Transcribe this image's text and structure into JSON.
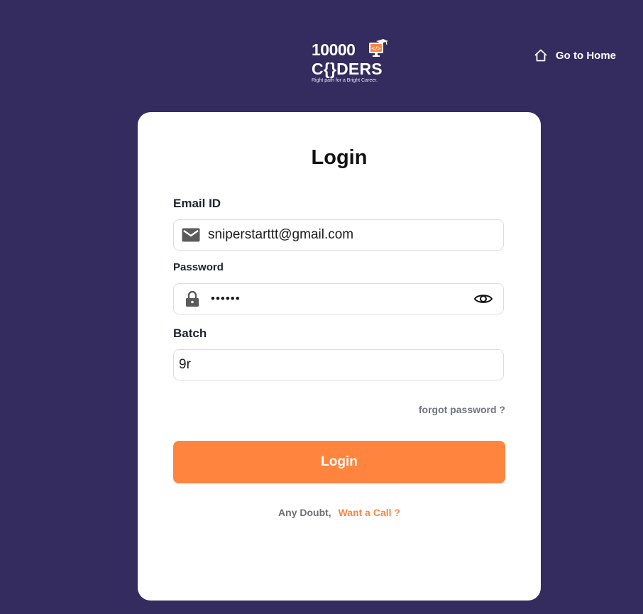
{
  "logo": {
    "number": "10000",
    "word": "C{}DERS",
    "tagline": "Right path for a Bright Career.",
    "monitor_code": "</>"
  },
  "header": {
    "home_label": "Go to Home",
    "home_icon": "home-icon"
  },
  "form": {
    "title": "Login",
    "email": {
      "label": "Email ID",
      "value": "sniperstarttt@gmail.com",
      "icon": "envelope-icon"
    },
    "password": {
      "label": "Password",
      "value": "••••••",
      "icon": "lock-icon",
      "toggle_icon": "eye-icon"
    },
    "batch": {
      "label": "Batch",
      "value": "9r"
    },
    "forgot_label": "forgot password ?",
    "submit_label": "Login",
    "doubt_text": "Any Doubt,",
    "call_label": "Want a Call ?"
  },
  "colors": {
    "background": "#342c5e",
    "accent": "#ff853f",
    "card": "#ffffff"
  }
}
